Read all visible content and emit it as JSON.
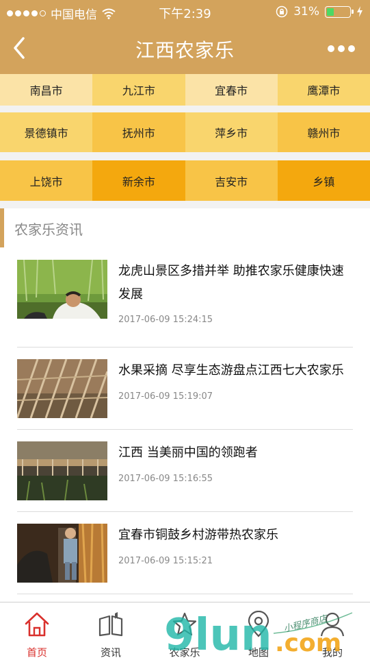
{
  "status_bar": {
    "carrier": "中国电信",
    "time": "下午2:39",
    "battery_percent": "31%",
    "battery_level": 0.31
  },
  "nav": {
    "title": "江西农家乐"
  },
  "cities": [
    [
      "南昌市",
      "九江市",
      "宜春市",
      "鹰潭市"
    ],
    [
      "景德镇市",
      "抚州市",
      "萍乡市",
      "赣州市"
    ],
    [
      "上饶市",
      "新余市",
      "吉安市",
      "乡镇"
    ]
  ],
  "colors": {
    "header": "#d3a35c",
    "accent_red": "#d9302c",
    "cell_colors": [
      [
        "#fbe3a7",
        "#f9d56d",
        "#fbe3a7",
        "#f9d56d"
      ],
      [
        "#f9d56d",
        "#f8c447",
        "#f9d56d",
        "#f8c447"
      ],
      [
        "#f8c447",
        "#f4a80e",
        "#f8c447",
        "#f4a80e"
      ]
    ]
  },
  "news": {
    "section_title": "农家乐资讯",
    "items": [
      {
        "title": "龙虎山景区多措并举 助推农家乐健康快速发展",
        "date": "2017-06-09 15:24:15",
        "thumb": "farmer-photo"
      },
      {
        "title": "水果采摘 尽享生态游盘点江西七大农家乐",
        "date": "2017-06-09 15:19:07",
        "thumb": "orchard-trellis-photo"
      },
      {
        "title": "江西 当美丽中国的领跑者",
        "date": "2017-06-09 15:16:55",
        "thumb": "wooden-bridge-photo"
      },
      {
        "title": "宜春市铜鼓乡村游带热农家乐",
        "date": "2017-06-09 15:15:21",
        "thumb": "child-village-photo"
      }
    ]
  },
  "tabs": [
    {
      "label": "首页",
      "icon": "home-icon",
      "active": true
    },
    {
      "label": "资讯",
      "icon": "book-icon",
      "active": false
    },
    {
      "label": "农家乐",
      "icon": "star-icon",
      "active": false
    },
    {
      "label": "地图",
      "icon": "map-pin-icon",
      "active": false
    },
    {
      "label": "我的",
      "icon": "user-icon",
      "active": false
    }
  ],
  "watermark": {
    "brand": "9lun",
    "domain": ".com",
    "script": "小程序商店"
  }
}
